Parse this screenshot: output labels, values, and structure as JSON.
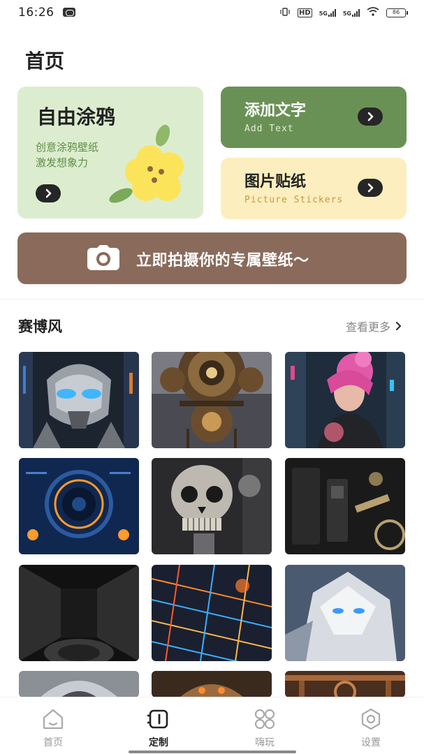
{
  "status_bar": {
    "time": "16:26",
    "network_labels": [
      "HD",
      "5G",
      "5G"
    ],
    "battery": "86"
  },
  "page_title": "首页",
  "cards": {
    "doodle": {
      "title": "自由涂鸦",
      "desc_line1": "创意涂鸦壁纸",
      "desc_line2": "激发想象力"
    },
    "add_text": {
      "title": "添加文字",
      "subtitle": "Add Text"
    },
    "stickers": {
      "title": "图片贴纸",
      "subtitle": "Picture Stickers"
    },
    "camera": {
      "label": "立即拍摄你的专属壁纸～"
    }
  },
  "section": {
    "title": "赛博风",
    "more_label": "查看更多"
  },
  "wallpapers": [
    {
      "name": "silver-robot-head",
      "icon": "robot"
    },
    {
      "name": "bronze-gear-machine",
      "icon": "gears"
    },
    {
      "name": "pink-hair-cyber-girl",
      "icon": "girl"
    },
    {
      "name": "blue-circuit-ring",
      "icon": "ring"
    },
    {
      "name": "mechanical-skull",
      "icon": "skull"
    },
    {
      "name": "dark-mechanical-panel",
      "icon": "panel"
    },
    {
      "name": "black-corridor",
      "icon": "corridor"
    },
    {
      "name": "neon-circuit-board",
      "icon": "circuit"
    },
    {
      "name": "white-mecha-dragon",
      "icon": "mecha"
    },
    {
      "name": "chrome-helmet",
      "icon": "helmet"
    },
    {
      "name": "copper-robot",
      "icon": "robot2"
    },
    {
      "name": "copper-pipes",
      "icon": "pipes"
    }
  ],
  "bottom_nav": [
    {
      "label": "首页",
      "icon": "home-icon",
      "active": false
    },
    {
      "label": "定制",
      "icon": "customize-icon",
      "active": true
    },
    {
      "label": "嗨玩",
      "icon": "apps-grid-icon",
      "active": false
    },
    {
      "label": "设置",
      "icon": "settings-icon",
      "active": false
    }
  ],
  "colors": {
    "doodle_bg": "#dcedcf",
    "add_text_bg": "#6a9155",
    "sticker_bg": "#fdeebf",
    "camera_bg": "#8a6b5b"
  }
}
